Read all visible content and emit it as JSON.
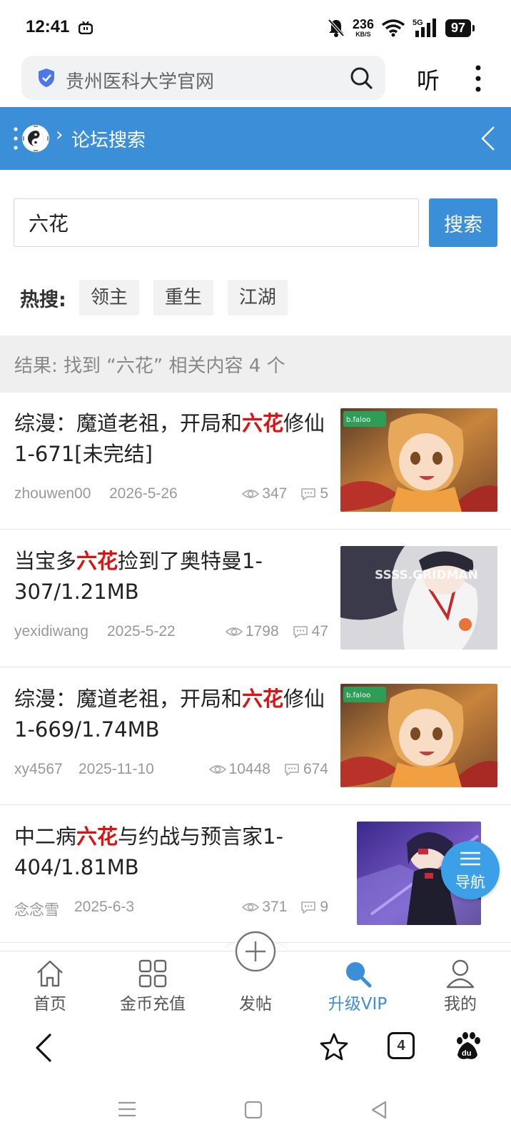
{
  "status_bar": {
    "time": "12:41",
    "net_speed": "236",
    "net_unit": "KB/S",
    "battery": "97",
    "icons": [
      "tv-icon",
      "mute-bell-icon",
      "wifi-icon",
      "5g-signal-icon",
      "battery-icon"
    ]
  },
  "browser": {
    "url_text": "贵州医科大学官网",
    "listen_label": "听",
    "toolbar": {
      "tab_count": "4"
    }
  },
  "forum_header": {
    "separator": "›",
    "title": "论坛搜索"
  },
  "search": {
    "query": "六花",
    "button_label": "搜索"
  },
  "hot": {
    "label": "热搜:",
    "tags": [
      "领主",
      "重生",
      "江湖"
    ]
  },
  "result_summary": "结果: 找到 “六花” 相关内容 4 个",
  "results": [
    {
      "title_pre": "综漫：魔道老祖，开局和",
      "title_hl": "六花",
      "title_post": "修仙1-671[未完结]",
      "user": "zhouwen00",
      "date": "2026-5-26",
      "views": "347",
      "comments": "5"
    },
    {
      "title_pre": "当宝多",
      "title_hl": "六花",
      "title_post": "捡到了奥特曼1-307/1.21MB",
      "user": "yexidiwang",
      "date": "2025-5-22",
      "views": "1798",
      "comments": "47",
      "thumb_text": "SSSS.GRIDMAN"
    },
    {
      "title_pre": "综漫：魔道老祖，开局和",
      "title_hl": "六花",
      "title_post": "修仙1-669/1.74MB",
      "user": "xy4567",
      "date": "2025-11-10",
      "views": "10448",
      "comments": "674"
    },
    {
      "title_pre": "中二病",
      "title_hl": "六花",
      "title_post": "与约战与预言家1-404/1.81MB",
      "user": "念念雪",
      "date": "2025-6-3",
      "views": "371",
      "comments": "9"
    }
  ],
  "nav_fab_label": "导航",
  "tabs": [
    {
      "label": "首页",
      "icon": "home-icon"
    },
    {
      "label": "金币充值",
      "icon": "grid-icon"
    },
    {
      "label": "发帖",
      "icon": "plus-circle-icon"
    },
    {
      "label": "升级VIP",
      "icon": "search-icon",
      "active": true
    },
    {
      "label": "我的",
      "icon": "user-icon"
    }
  ],
  "colors": {
    "accent": "#3b8fd8",
    "highlight": "#e01010",
    "fab": "#3ba0e8"
  }
}
